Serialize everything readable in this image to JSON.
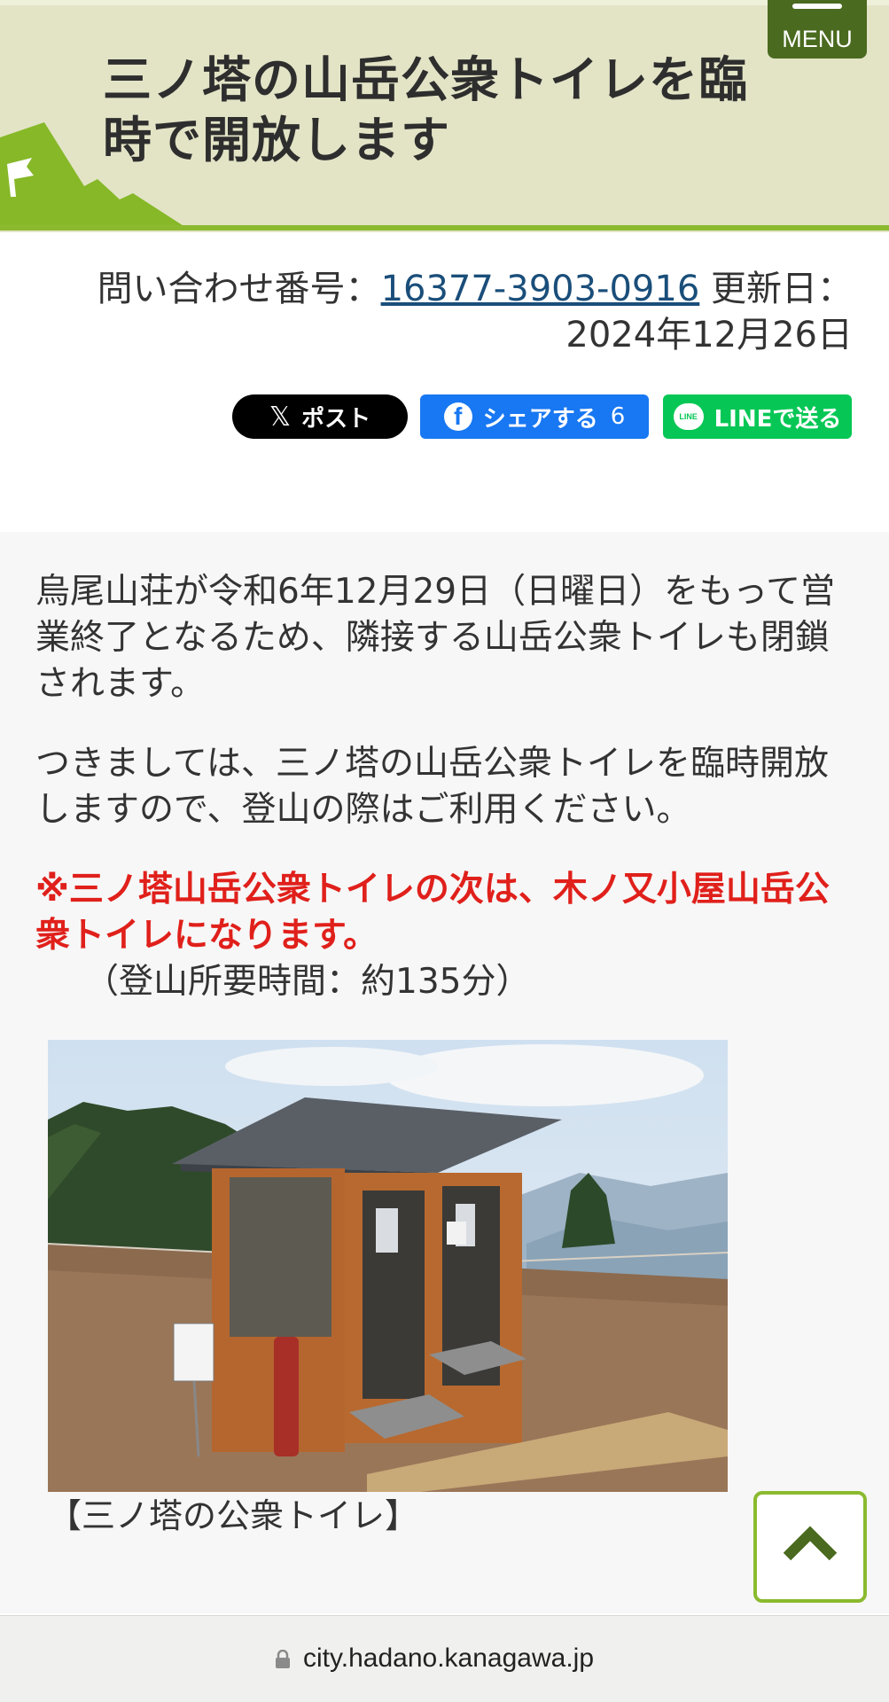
{
  "header": {
    "title": "三ノ塔の山岳公衆トイレを臨時で開放します",
    "menu_label": "MENU"
  },
  "meta": {
    "inquiry_label": "問い合わせ番号：",
    "inquiry_number": "16377-3903-0916",
    "updated_label": " 更新日：",
    "updated_date": "2024年12月26日"
  },
  "share": {
    "x_label": "ポスト",
    "facebook_label": "シェアする",
    "facebook_count": "6",
    "line_label": "LINEで送る"
  },
  "content": {
    "paragraph1": "烏尾山荘が令和6年12月29日（日曜日）をもって営業終了となるため、隣接する山岳公衆トイレも閉鎖されます。",
    "paragraph2": "つきましては、三ノ塔の山岳公衆トイレを臨時開放しますので、登山の際はご利用ください。",
    "notice": "※三ノ塔山岳公衆トイレの次は、木ノ又小屋山岳公衆トイレになります。",
    "duration": "（登山所要時間：約135分）",
    "photo_caption": "【三ノ塔の公衆トイレ】"
  },
  "browser": {
    "url": "city.hadano.kanagawa.jp"
  },
  "colors": {
    "banner": "#e3e4c6",
    "accent_green": "#8bba2f",
    "menu_green": "#4a6a1f",
    "notice_red": "#e0201b",
    "link_blue": "#1a4e7a"
  }
}
